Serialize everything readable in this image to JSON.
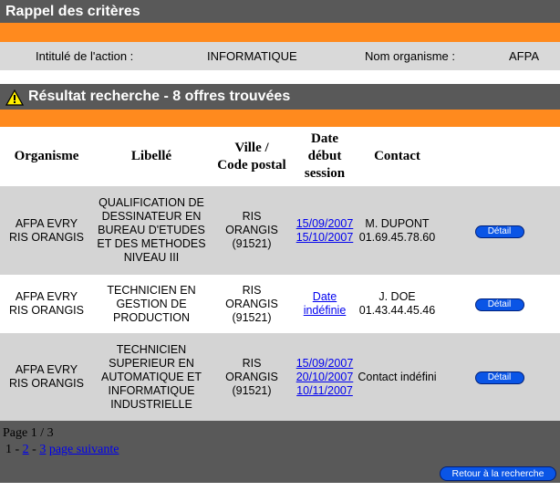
{
  "criteria": {
    "title": "Rappel des critères",
    "label_action": "Intitulé de l'action :",
    "value_action": "INFORMATIQUE",
    "label_org": "Nom organisme :",
    "value_org": "AFPA"
  },
  "results": {
    "title": "Résultat recherche - 8 offres trouvées",
    "headers": {
      "organisme": "Organisme",
      "libelle": "Libellé",
      "ville_1": "Ville /",
      "ville_2": "Code postal",
      "date_1": "Date",
      "date_2": "début",
      "date_3": "session",
      "contact": "Contact"
    },
    "rows": [
      {
        "org_1": "AFPA EVRY",
        "org_2": "RIS ORANGIS",
        "lib": [
          "QUALIFICATION DE",
          "DESSINATEUR EN",
          "BUREAU D'ETUDES",
          "ET DES METHODES",
          "NIVEAU III"
        ],
        "ville": [
          "RIS",
          "ORANGIS",
          "(91521)"
        ],
        "dates": [
          "15/09/2007",
          "15/10/2007"
        ],
        "contact_1": "M. DUPONT",
        "contact_2": "01.69.45.78.60",
        "detail": "Détail"
      },
      {
        "org_1": "AFPA EVRY",
        "org_2": "RIS ORANGIS",
        "lib": [
          "TECHNICIEN EN",
          "GESTION DE",
          "PRODUCTION"
        ],
        "ville": [
          "RIS",
          "ORANGIS",
          "(91521)"
        ],
        "dates": [
          "Date",
          "indéfinie"
        ],
        "contact_1": "J. DOE",
        "contact_2": "01.43.44.45.46",
        "detail": "Détail"
      },
      {
        "org_1": "AFPA EVRY",
        "org_2": "RIS ORANGIS",
        "lib": [
          "TECHNICIEN",
          "SUPERIEUR EN",
          "AUTOMATIQUE ET",
          "INFORMATIQUE",
          "INDUSTRIELLE"
        ],
        "ville": [
          "RIS",
          "ORANGIS",
          "(91521)"
        ],
        "dates": [
          "15/09/2007",
          "20/10/2007",
          "10/11/2007"
        ],
        "contact_1": "Contact indéfini",
        "contact_2": "",
        "detail": "Détail"
      }
    ]
  },
  "pagination": {
    "page_info": "Page 1 / 3",
    "current": "1",
    "sep": "-",
    "p2": "2",
    "p3": "3",
    "next": "page suivante"
  },
  "back_button": "Retour à la recherche"
}
